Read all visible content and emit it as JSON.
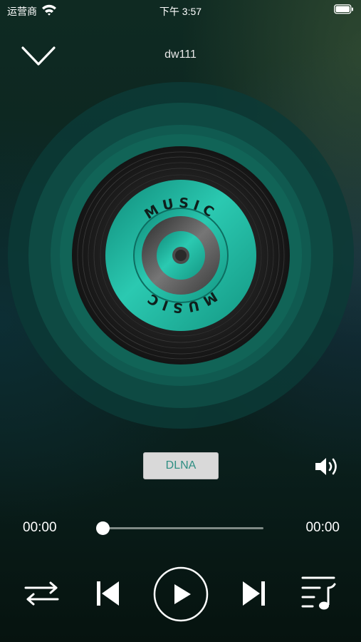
{
  "status_bar": {
    "carrier": "运营商",
    "time": "下午 3:57"
  },
  "header": {
    "title": "dw111"
  },
  "disc": {
    "label_top": "MUSIC",
    "label_bottom": "MUSIC"
  },
  "controls": {
    "dlna_label": "DLNA",
    "current_time": "00:00",
    "total_time": "00:00",
    "progress": 0
  },
  "colors": {
    "accent": "#1fa893",
    "disc": "#1c1c1c"
  },
  "icons": [
    "wifi-icon",
    "battery-icon",
    "chevron-down-icon",
    "volume-icon",
    "shuffle-icon",
    "previous-icon",
    "play-icon",
    "next-icon",
    "playlist-icon"
  ]
}
